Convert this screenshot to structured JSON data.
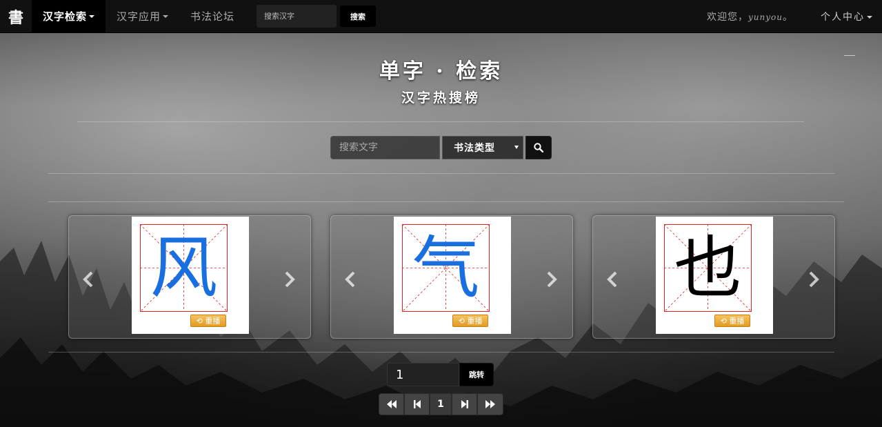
{
  "nav": {
    "brand": "書",
    "items": [
      {
        "label": "汉字检索",
        "dropdown": true,
        "active": true
      },
      {
        "label": "汉字应用",
        "dropdown": true,
        "active": false
      },
      {
        "label": "书法论坛",
        "dropdown": false,
        "active": false
      }
    ],
    "search_placeholder": "搜索汉字",
    "search_button": "搜索",
    "welcome_prefix": "欢迎您，",
    "username": "yunyou",
    "welcome_suffix": "。",
    "user_center": "个人中心"
  },
  "header": {
    "title": "单字 · 检索",
    "subtitle": "汉字热搜榜"
  },
  "search": {
    "placeholder": "搜索文字",
    "type_select": "书法类型"
  },
  "cards": [
    {
      "char": "风",
      "color": "#1a6fe0",
      "replay": "重播"
    },
    {
      "char": "气",
      "color": "#1a6fe0",
      "replay": "重播"
    },
    {
      "char": "也",
      "color": "#000000",
      "replay": "重播"
    }
  ],
  "pagination": {
    "jump_value": "1",
    "jump_button": "跳转",
    "current_page": "1"
  },
  "colors": {
    "navbar": "#111111",
    "replay_button": "#e9a534",
    "grid_red": "#e02020",
    "stroke_blue": "#1a6fe0"
  }
}
